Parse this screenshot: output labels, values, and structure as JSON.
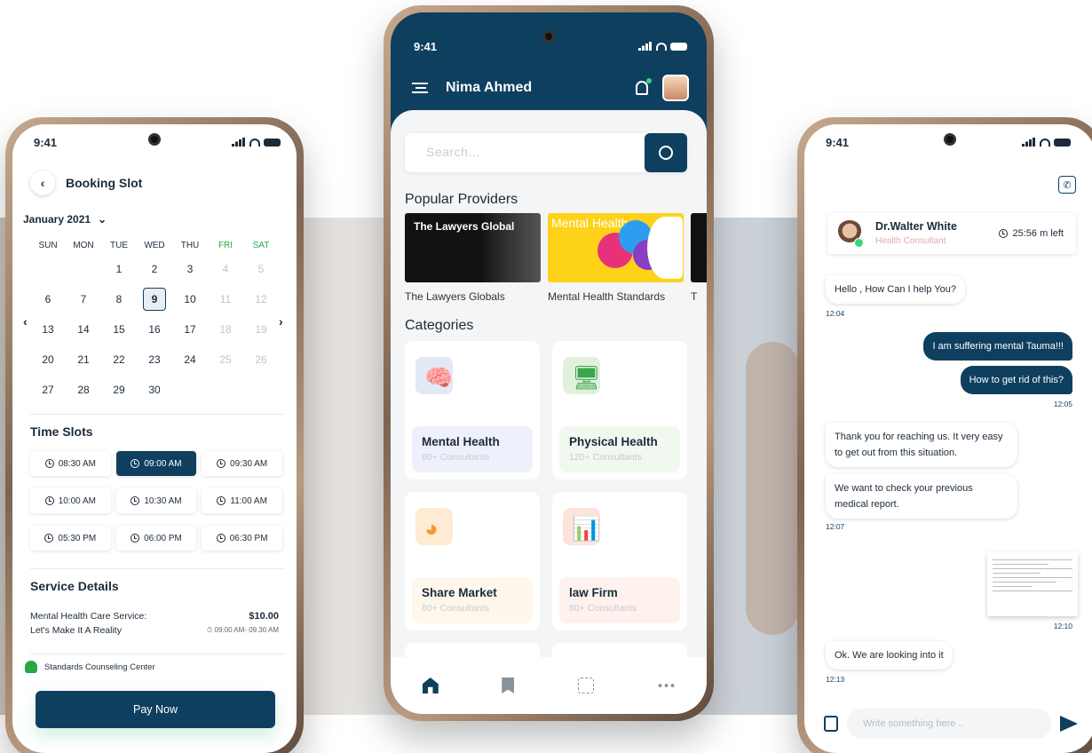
{
  "booking": {
    "time": "9:41",
    "title": "Booking Slot",
    "month": "January 2021",
    "weekdays": [
      "SUN",
      "MON",
      "TUE",
      "WED",
      "THU",
      "FRI",
      "SAT"
    ],
    "weeks": [
      [
        "",
        "",
        "1",
        "2",
        "3",
        "4",
        "5"
      ],
      [
        "6",
        "7",
        "8",
        "9",
        "10",
        "11",
        "12"
      ],
      [
        "13",
        "14",
        "15",
        "16",
        "17",
        "18",
        "19"
      ],
      [
        "20",
        "21",
        "22",
        "23",
        "24",
        "25",
        "26"
      ],
      [
        "27",
        "28",
        "29",
        "30",
        "",
        "",
        ""
      ]
    ],
    "selected_day": "9",
    "time_slots_title": "Time Slots",
    "slots": [
      "08:30 AM",
      "09:00 AM",
      "09:30 AM",
      "10:00 AM",
      "10:30 AM",
      "11:00 AM",
      "05:30 PM",
      "06:00 PM",
      "06:30 PM"
    ],
    "active_slot": "09:00 AM",
    "service_title": "Service Details",
    "service_line1": "Mental Health Care Service:",
    "service_line2": "Let's Make It  A Reality",
    "price": "$10.00",
    "service_time": "09:00 AM- 09.30 AM",
    "center": "Standards Counseling Center",
    "pay_label": "Pay Now"
  },
  "home": {
    "time": "9:41",
    "user_name": "Nima Ahmed",
    "search_placeholder": "Search...",
    "popular_title": "Popular Providers",
    "providers": [
      {
        "name": "The Lawyers Globals",
        "logo_text": "The Lawyers Global"
      },
      {
        "name": "Mental Health Standards",
        "logo_text": "Mental Health"
      },
      {
        "name": "T"
      }
    ],
    "categories_title": "Categories",
    "categories": [
      {
        "name": "Mental Health",
        "count": "80+ Consultants",
        "icon": "brain-head-icon",
        "tint": "#eef1fb",
        "iconbg": "#e3e8f7"
      },
      {
        "name": "Physical Health",
        "count": "120+ Consultants",
        "icon": "monitor-icon",
        "tint": "#f1f8ef",
        "iconbg": "#e2f1dc"
      },
      {
        "name": "Share Market",
        "count": "80+ Consultants",
        "icon": "pie-chart-icon",
        "tint": "#fff7ec",
        "iconbg": "#fdebd3"
      },
      {
        "name": "law Firm",
        "count": "80+ Consultants",
        "icon": "presentation-icon",
        "tint": "#fff2ee",
        "iconbg": "#fde4db"
      }
    ],
    "nav": [
      "home-icon",
      "bookmark-icon",
      "calendar-icon",
      "more-icon"
    ]
  },
  "chat": {
    "time": "9:41",
    "doctor_name": "Dr.Walter White",
    "doctor_role": "Health Consultant",
    "time_left": "25:56 m left",
    "messages": [
      {
        "text": "Hello , How Can I help You?",
        "ts": "12:04"
      },
      {
        "text": "I am suffering mental Tauma!!!"
      },
      {
        "text": "How to get rid of this?",
        "ts": "12:05"
      },
      {
        "text": "Thank you for reaching us. It very easy to get out from this situation."
      },
      {
        "text": "We want to check your previous medical report.",
        "ts": "12:07"
      },
      {
        "ts": "12:10"
      },
      {
        "text": "Ok. We are looking into it",
        "ts": "12:13"
      }
    ],
    "composer_placeholder": "Write something here .."
  },
  "colors": {
    "primary": "#0f3f5f",
    "weekend": "#27a844",
    "online": "#37d67a"
  }
}
